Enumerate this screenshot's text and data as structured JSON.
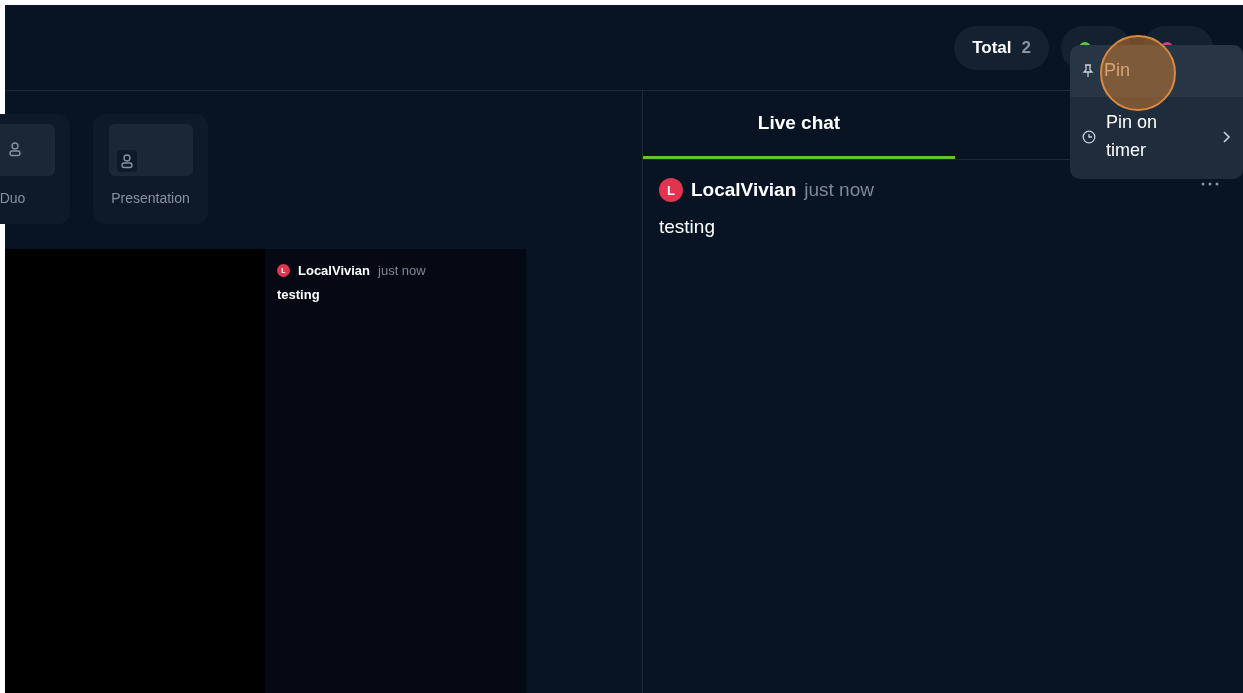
{
  "header": {
    "counters": [
      {
        "label": "Total",
        "count": "2",
        "kind": "text"
      },
      {
        "kind": "dot",
        "color": "#5cc535"
      },
      {
        "kind": "dot",
        "color": "#d63a8a"
      }
    ]
  },
  "layouts": [
    {
      "label": "Duo",
      "selected": false
    },
    {
      "label": "Presentation",
      "selected": false
    }
  ],
  "stage": {
    "overlay_message": {
      "author": "LocalVivian",
      "avatar": "L",
      "time": "just now",
      "text": "testing"
    }
  },
  "chat": {
    "tabs": [
      {
        "label": "Live chat",
        "selected": true
      }
    ],
    "messages": [
      {
        "author": "LocalVivian",
        "avatar": "L",
        "time": "just now",
        "text": "testing"
      }
    ]
  },
  "context_menu": {
    "items": [
      {
        "label": "Pin",
        "kind": "pin",
        "highlighted": true,
        "submenu": false
      },
      {
        "label": "Pin on timer",
        "kind": "timer",
        "highlighted": false,
        "submenu": true
      }
    ]
  }
}
